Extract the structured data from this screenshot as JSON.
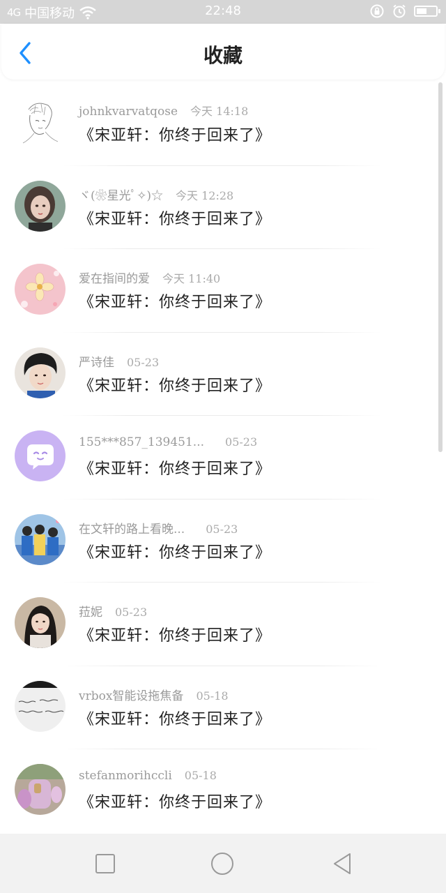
{
  "status_bar": {
    "signal": "4G",
    "carrier": "中国移动",
    "time": "22:48",
    "battery_level": 0.55
  },
  "header": {
    "title": "收藏"
  },
  "favorites": [
    {
      "name": "johnkvarvatqose",
      "date": "今天 14:18",
      "message": "《宋亚轩：你终于回来了》"
    },
    {
      "name": "ヾ(❀星光ﾟ✧)☆",
      "date": "今天 12:28",
      "message": "《宋亚轩：你终于回来了》"
    },
    {
      "name": "爱在指间的爱",
      "date": "今天 11:40",
      "message": "《宋亚轩：你终于回来了》"
    },
    {
      "name": "严诗佳",
      "date": "05-23",
      "message": "《宋亚轩：你终于回来了》"
    },
    {
      "name": "155***857_139451...",
      "date": "05-23",
      "message": "《宋亚轩：你终于回来了》"
    },
    {
      "name": "在文轩的路上看晚...",
      "date": "05-23",
      "message": "《宋亚轩：你终于回来了》"
    },
    {
      "name": "菈妮",
      "date": "05-23",
      "message": "《宋亚轩：你终于回来了》"
    },
    {
      "name": "vrbox智能设拖焦备",
      "date": "05-18",
      "message": "《宋亚轩：你终于回来了》"
    },
    {
      "name": "stefanmorihccli",
      "date": "05-18",
      "message": "《宋亚轩：你终于回来了》"
    }
  ],
  "colors": {
    "accent": "#1e90ff",
    "status_bar_bg": "#d6d6d6",
    "nav_bar_bg": "#f2f2f2"
  }
}
